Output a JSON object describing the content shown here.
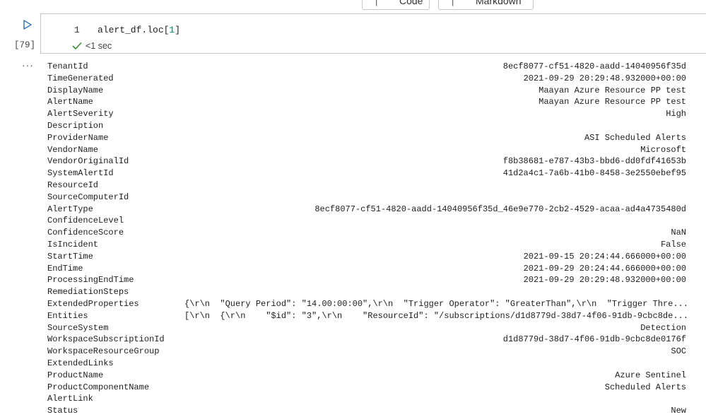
{
  "toolbar": {
    "code_label": "Code",
    "markdown_label": "Markdown"
  },
  "cell": {
    "execution_count": "[79]",
    "line_number": "1",
    "code_prefix": "alert_df.loc[",
    "code_index": "1",
    "code_suffix": "]",
    "status_text": "<1 sec",
    "output_toggle": "···"
  },
  "output": {
    "rows": [
      {
        "key": "TenantId",
        "value": "8ecf8077-cf51-4820-aadd-14040956f35d"
      },
      {
        "key": "TimeGenerated",
        "value": "2021-09-29 20:29:48.932000+00:00"
      },
      {
        "key": "DisplayName",
        "value": "Maayan Azure Resource PP test"
      },
      {
        "key": "AlertName",
        "value": "Maayan Azure Resource PP test"
      },
      {
        "key": "AlertSeverity",
        "value": "High"
      },
      {
        "key": "Description",
        "value": ""
      },
      {
        "key": "ProviderName",
        "value": "ASI Scheduled Alerts"
      },
      {
        "key": "VendorName",
        "value": "Microsoft"
      },
      {
        "key": "VendorOriginalId",
        "value": "f8b38681-e787-43b3-bbd6-dd0fdf41653b"
      },
      {
        "key": "SystemAlertId",
        "value": "41d2a4c1-7a6b-41b0-8458-3e2550ebef95"
      },
      {
        "key": "ResourceId",
        "value": ""
      },
      {
        "key": "SourceComputerId",
        "value": ""
      },
      {
        "key": "AlertType",
        "value": "8ecf8077-cf51-4820-aadd-14040956f35d_46e9e770-2cb2-4529-acaa-ad4a4735480d"
      },
      {
        "key": "ConfidenceLevel",
        "value": ""
      },
      {
        "key": "ConfidenceScore",
        "value": "NaN"
      },
      {
        "key": "IsIncident",
        "value": "False"
      },
      {
        "key": "StartTime",
        "value": "2021-09-15 20:24:44.666000+00:00"
      },
      {
        "key": "EndTime",
        "value": "2021-09-29 20:24:44.666000+00:00"
      },
      {
        "key": "ProcessingEndTime",
        "value": "2021-09-29 20:29:48.932000+00:00"
      },
      {
        "key": "RemediationSteps",
        "value": ""
      },
      {
        "key": "ExtendedProperties",
        "value": "{\\r\\n  \"Query Period\": \"14.00:00:00\",\\r\\n  \"Trigger Operator\": \"GreaterThan\",\\r\\n  \"Trigger Thre..."
      },
      {
        "key": "Entities",
        "value": "[\\r\\n  {\\r\\n    \"$id\": \"3\",\\r\\n    \"ResourceId\": \"/subscriptions/d1d8779d-38d7-4f06-91db-9cbc8de..."
      },
      {
        "key": "SourceSystem",
        "value": "Detection"
      },
      {
        "key": "WorkspaceSubscriptionId",
        "value": "d1d8779d-38d7-4f06-91db-9cbc8de0176f"
      },
      {
        "key": "WorkspaceResourceGroup",
        "value": "SOC"
      },
      {
        "key": "ExtendedLinks",
        "value": ""
      },
      {
        "key": "ProductName",
        "value": "Azure Sentinel"
      },
      {
        "key": "ProductComponentName",
        "value": "Scheduled Alerts"
      },
      {
        "key": "AlertLink",
        "value": ""
      },
      {
        "key": "Status",
        "value": "New"
      }
    ]
  },
  "colors": {
    "accent_blue": "#1a63b4",
    "success_green": "#388a34",
    "number_green": "#098658"
  },
  "icons": {
    "run": "play-icon",
    "status": "check-icon"
  }
}
